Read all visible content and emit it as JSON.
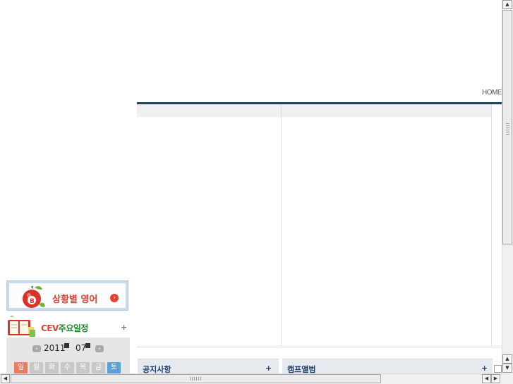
{
  "header": {
    "home_link": "HOME"
  },
  "sidebar": {
    "banner": {
      "label": "상황별 영어",
      "arrow": "›"
    },
    "schedule": {
      "title_prefix": "CEV",
      "title_rest": "주요일정",
      "more": "+",
      "year": "2011",
      "month": "07",
      "prev": "‹",
      "next": "›",
      "days": [
        "일",
        "월",
        "화",
        "수",
        "목",
        "금",
        "토"
      ]
    }
  },
  "boxes": {
    "notice": {
      "title": "공지사항",
      "more": "+"
    },
    "album": {
      "title": "캠프앨범",
      "more": "+"
    }
  },
  "scrollbars": {
    "up": "▲",
    "down": "▼",
    "left": "◀",
    "right": "▶"
  },
  "colors": {
    "top_rule": "#0f4d63",
    "accent_red": "#e8402e",
    "accent_green": "#1d8a2a",
    "box_title": "#1a3d6b"
  },
  "icons": [
    "apple-character-icon",
    "calendar-book-icon",
    "arrow-right-icon",
    "chevron-left-icon",
    "chevron-right-icon"
  ]
}
